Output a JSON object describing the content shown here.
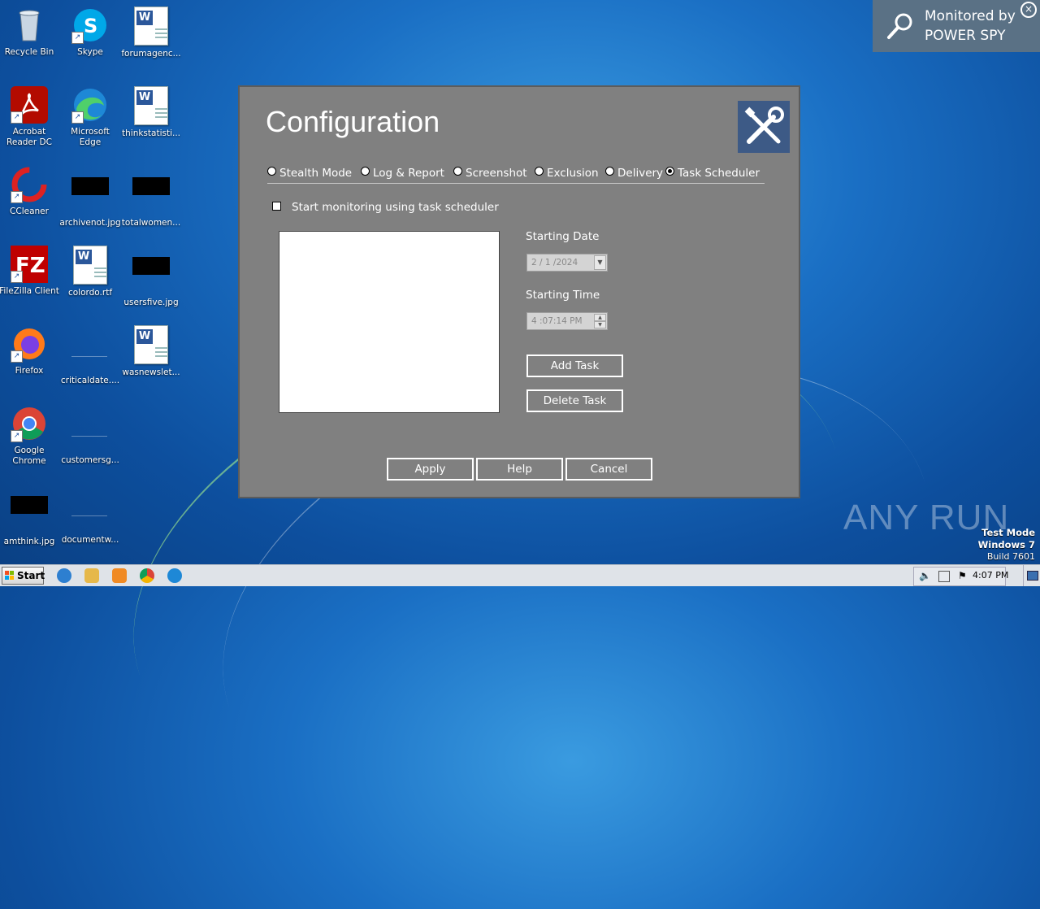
{
  "desktop": {
    "icons": [
      {
        "label": "Recycle Bin"
      },
      {
        "label": "Skype"
      },
      {
        "label": "forumagenc..."
      },
      {
        "label": "Acrobat\nReader DC"
      },
      {
        "label": "Microsoft Edge"
      },
      {
        "label": "thinkstatisti..."
      },
      {
        "label": "CCleaner"
      },
      {
        "label": "archivenot.jpg"
      },
      {
        "label": "totalwomen..."
      },
      {
        "label": "FileZilla Client"
      },
      {
        "label": "colordo.rtf"
      },
      {
        "label": "usersfive.jpg"
      },
      {
        "label": "Firefox"
      },
      {
        "label": "criticaldate...."
      },
      {
        "label": "wasnewslet..."
      },
      {
        "label": "Google\nChrome"
      },
      {
        "label": "customersg..."
      },
      {
        "label": "amthink.jpg"
      },
      {
        "label": "documentw..."
      }
    ]
  },
  "monitor_banner": {
    "line1": "Monitored by",
    "line2": "POWER SPY",
    "close": "×"
  },
  "dialog": {
    "title": "Configuration",
    "tabs": [
      {
        "label": "Stealth Mode",
        "selected": false
      },
      {
        "label": "Log & Report",
        "selected": false
      },
      {
        "label": "Screenshot",
        "selected": false
      },
      {
        "label": "Exclusion",
        "selected": false
      },
      {
        "label": "Delivery",
        "selected": false
      },
      {
        "label": "Task Scheduler",
        "selected": true
      }
    ],
    "checkbox_label": "Start monitoring using task scheduler",
    "starting_date_label": "Starting Date",
    "starting_date_value": "2 / 1 /2024",
    "starting_time_label": "Starting Time",
    "starting_time_value": "4 :07:14 PM",
    "add_task": "Add Task",
    "delete_task": "Delete Task",
    "apply": "Apply",
    "help": "Help",
    "cancel": "Cancel"
  },
  "watermark": {
    "brand": "ANY RUN",
    "mode": "Test Mode",
    "os": "Windows 7",
    "build": "Build 7601"
  },
  "taskbar": {
    "start_label": "Start",
    "clock": "4:07 PM"
  }
}
